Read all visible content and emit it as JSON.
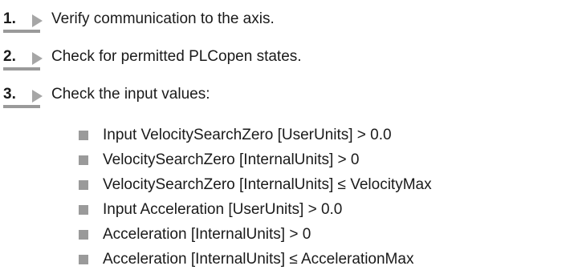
{
  "steps": [
    {
      "number": "1.",
      "text": "Verify communication to the axis."
    },
    {
      "number": "2.",
      "text": "Check for permitted PLCopen states."
    },
    {
      "number": "3.",
      "text": "Check the input values:"
    }
  ],
  "bullets": [
    "Input VelocitySearchZero [UserUnits] > 0.0",
    "VelocitySearchZero [InternalUnits] > 0",
    "VelocitySearchZero [InternalUnits] ≤ VelocityMax",
    "Input Acceleration [UserUnits] > 0.0",
    "Acceleration [InternalUnits] > 0",
    "Acceleration [InternalUnits] ≤ AccelerationMax"
  ],
  "icons": {
    "step_arrow": "arrow-right-icon",
    "bullet": "square-bullet-icon"
  },
  "colors": {
    "text": "#1a1a1a",
    "accent_gray": "#9a9a9a"
  }
}
